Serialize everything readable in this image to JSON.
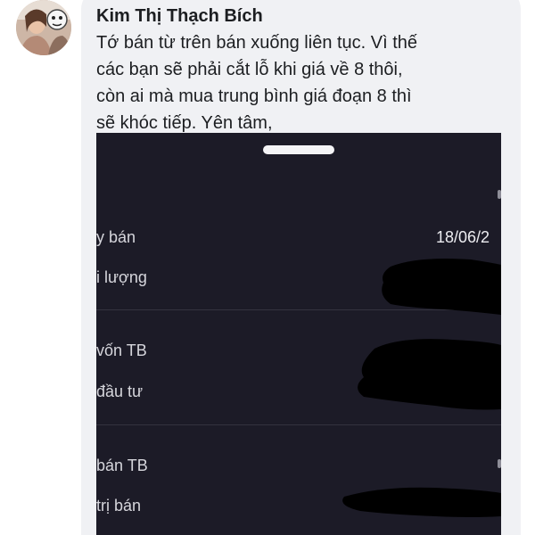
{
  "post": {
    "author_name": "Kim Thị Thạch Bích",
    "message_lines": [
      "Tớ bán từ trên bán xuống liên tục. Vì thế",
      "các bạn sẽ phải cắt lỗ khi giá về 8 thôi,",
      "còn ai mà mua trung bình giá đoạn 8 thì",
      "sẽ khóc tiếp. Yên tâm,"
    ]
  },
  "screenshot": {
    "rows": [
      {
        "label": "y bán",
        "value": "18/06/2"
      },
      {
        "label": "i lượng",
        "value": ""
      },
      {
        "label": "vốn TB",
        "value": ""
      },
      {
        "label": "đầu tư",
        "value": ""
      },
      {
        "label": "bán TB",
        "value": ""
      },
      {
        "label": "trị bán",
        "value": ""
      }
    ]
  },
  "colors": {
    "bubble": "#f0f1f4",
    "screenshot_bg": "#1c1b27",
    "redaction": "#000000"
  }
}
